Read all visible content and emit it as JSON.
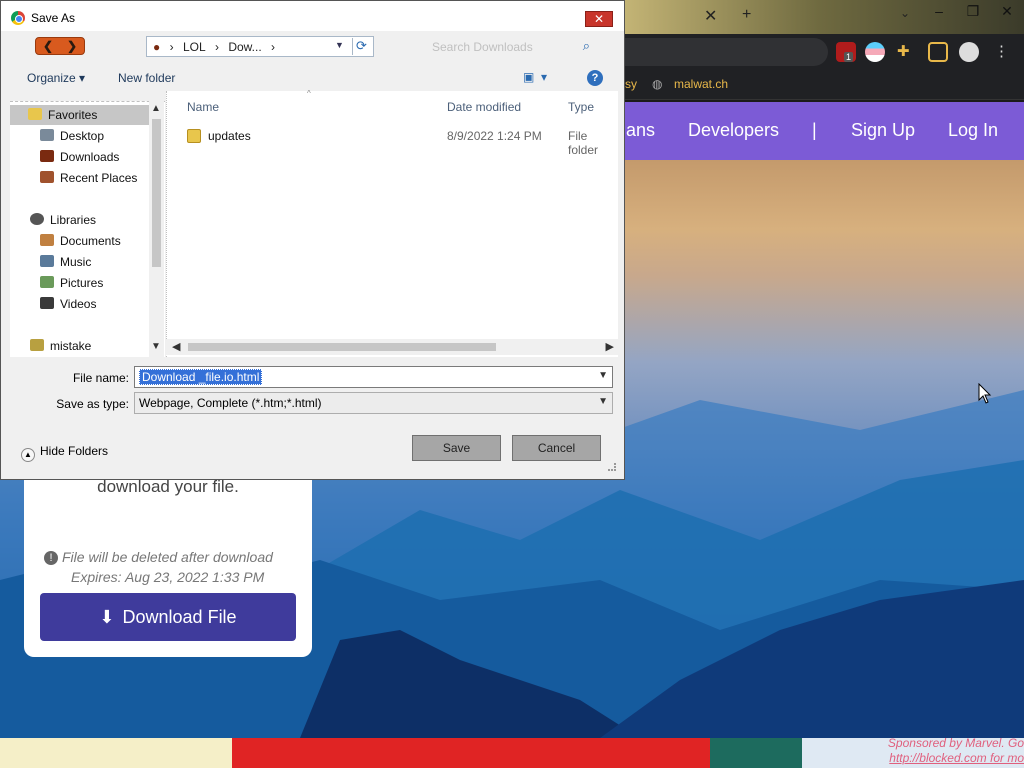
{
  "dialog": {
    "title": "Save As",
    "close_label": "✕",
    "nav": {
      "back": "❮",
      "forward": "❯"
    },
    "address": {
      "crumbs": [
        "LOL",
        "Dow..."
      ],
      "separator": "›"
    },
    "search_placeholder": "Search Downloads",
    "toolbar": {
      "organize": "Organize ▾",
      "new_folder": "New folder",
      "help": "?"
    },
    "nav_pane": {
      "favorites": "Favorites",
      "favorites_items": [
        "Desktop",
        "Downloads",
        "Recent Places"
      ],
      "libraries": "Libraries",
      "library_items": [
        "Documents",
        "Music",
        "Pictures",
        "Videos"
      ],
      "other": "mistake"
    },
    "columns": {
      "name": "Name",
      "date": "Date modified",
      "type": "Type"
    },
    "files": [
      {
        "name": "updates",
        "date": "8/9/2022 1:24 PM",
        "type": "File folder"
      }
    ],
    "file_name_label": "File name:",
    "file_name_value": "Download _file.io.html",
    "save_type_label": "Save as type:",
    "save_type_value": "Webpage, Complete (*.htm;*.html)",
    "hide_folders": "Hide Folders",
    "save_button": "Save",
    "cancel_button": "Cancel"
  },
  "browser": {
    "bookmarks": [
      "sy",
      "malwat.ch"
    ],
    "nav_links": [
      "ans",
      "Developers",
      "|",
      "Sign Up",
      "Log In"
    ],
    "extension_badge": "1"
  },
  "card": {
    "text": "download your file.",
    "warning_line1": "File will be deleted after download",
    "warning_line2": "Expires: Aug 23, 2022 1:33 PM",
    "download_button": "Download File"
  },
  "footer": {
    "sponsor_line1": "Sponsored by Marvel. Go",
    "sponsor_line2": "http://blocked.com for mo"
  },
  "colors": {
    "site_nav": "#7c5bd6",
    "download_button": "#3f3b9c",
    "selection": "#3470d8"
  }
}
